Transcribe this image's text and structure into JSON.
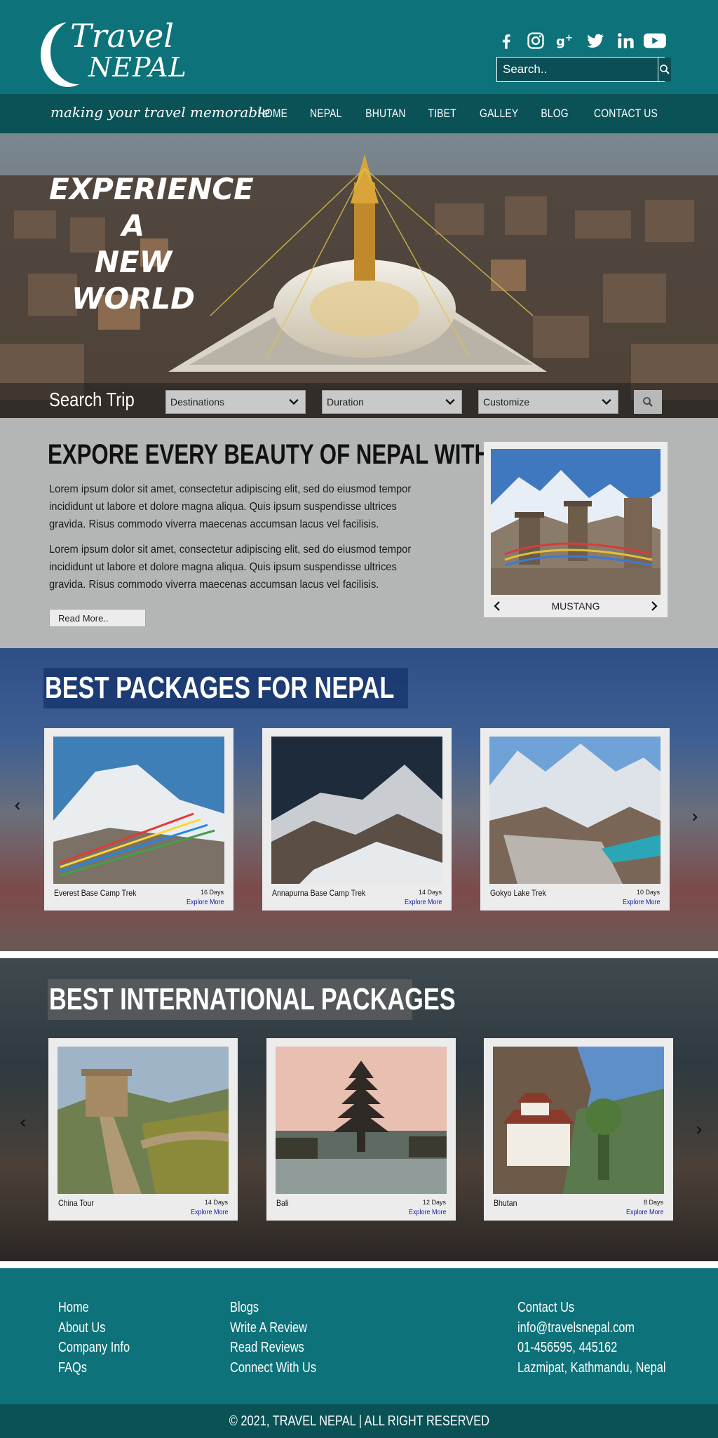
{
  "brand": {
    "line1": "Travel",
    "line2": "NEPAL",
    "tagline": "making your travel memorable"
  },
  "header": {
    "social": [
      "facebook-icon",
      "instagram-icon",
      "google-plus-icon",
      "twitter-icon",
      "linkedin-icon",
      "youtube-icon"
    ],
    "search_placeholder": "Search.."
  },
  "nav": {
    "items": [
      "HOME",
      "NEPAL",
      "BHUTAN",
      "TIBET",
      "GALLEY",
      "BLOG",
      "CONTACT US"
    ]
  },
  "hero": {
    "headline": [
      "EXPERIENCE",
      "A",
      "NEW WORLD"
    ],
    "search_label": "Search Trip",
    "selects": [
      "Destinations",
      "Duration",
      "Customize"
    ]
  },
  "intro": {
    "title": "EXPORE EVERY BEAUTY OF NEPAL WITH US",
    "paragraphs": [
      "Lorem ipsum dolor sit amet, consectetur adipiscing elit, sed do eiusmod tempor incididunt ut labore et dolore magna aliqua. Quis ipsum suspendisse ultrices gravida. Risus commodo viverra maecenas accumsan lacus vel facilisis.",
      "Lorem ipsum dolor sit amet, consectetur adipiscing elit, sed do eiusmod tempor incididunt ut labore et dolore magna aliqua. Quis ipsum suspendisse ultrices gravida. Risus commodo viverra maecenas accumsan lacus vel facilisis."
    ],
    "read_more": "Read More..",
    "featured_caption": "MUSTANG"
  },
  "nepal_packages": {
    "title": "BEST PACKAGES FOR NEPAL",
    "items": [
      {
        "name": "Everest Base Camp Trek",
        "days": "16 Days",
        "cta": "Explore More"
      },
      {
        "name": "Annapurna Base Camp Trek",
        "days": "14 Days",
        "cta": "Explore More"
      },
      {
        "name": "Gokyo Lake Trek",
        "days": "10 Days",
        "cta": "Explore More"
      }
    ]
  },
  "intl_packages": {
    "title": "BEST INTERNATIONAL PACKAGES",
    "items": [
      {
        "name": "China Tour",
        "days": "14 Days",
        "cta": "Explore More"
      },
      {
        "name": "Bali",
        "days": "12 Days",
        "cta": "Explore More"
      },
      {
        "name": "Bhutan",
        "days": "8 Days",
        "cta": "Explore More"
      }
    ]
  },
  "footer": {
    "col1": [
      "Home",
      "About Us",
      "Company Info",
      "FAQs"
    ],
    "col2": [
      "Blogs",
      "Write A Review",
      "Read Reviews",
      "Connect With Us"
    ],
    "col3": [
      "Contact Us",
      "info@travelsnepal.com",
      "01-456595, 445162",
      "Lazmipat, Kathmandu, Nepal"
    ],
    "copyright": "© 2021, TRAVEL NEPAL | ALL RIGHT RESERVED"
  },
  "colors": {
    "primary": "#0d7279",
    "primary_dark": "#0b5257",
    "intro_bg": "#b4b6b6",
    "link": "#1a22a8"
  }
}
